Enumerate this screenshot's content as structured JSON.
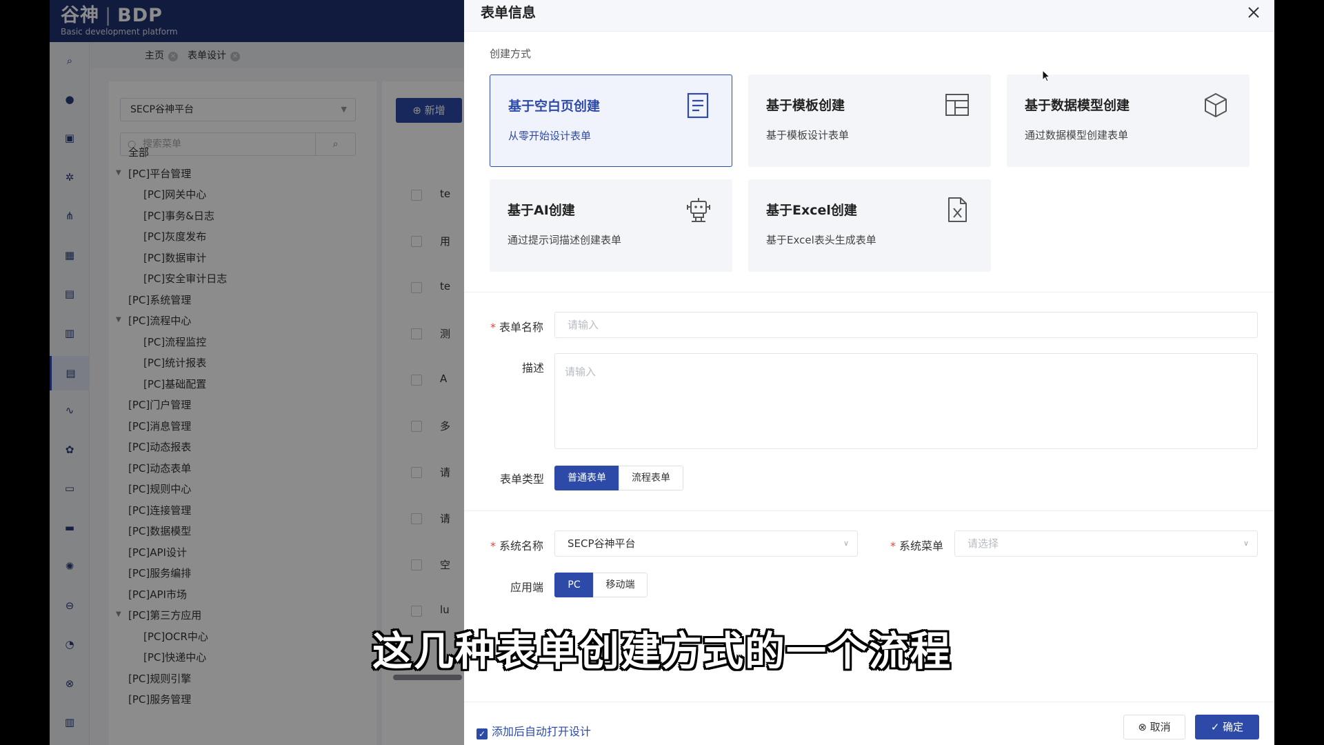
{
  "app": {
    "logo_brand": "谷神",
    "logo_name": "BDP",
    "logo_subtitle": "Basic development platform",
    "tabs": [
      {
        "label": "主页"
      },
      {
        "label": "表单设计"
      }
    ],
    "system_select": "SECP谷神平台",
    "menu_search_placeholder": "搜索菜单",
    "tree": [
      {
        "label": "全部",
        "level": 0,
        "caret": false
      },
      {
        "label": "[PC]平台管理",
        "level": 0,
        "caret": true
      },
      {
        "label": "[PC]网关中心",
        "level": 1,
        "caret": false
      },
      {
        "label": "[PC]事务&日志",
        "level": 1,
        "caret": false
      },
      {
        "label": "[PC]灰度发布",
        "level": 1,
        "caret": false
      },
      {
        "label": "[PC]数据审计",
        "level": 1,
        "caret": false
      },
      {
        "label": "[PC]安全审计日志",
        "level": 1,
        "caret": false
      },
      {
        "label": "[PC]系统管理",
        "level": 0,
        "caret": false
      },
      {
        "label": "[PC]流程中心",
        "level": 0,
        "caret": true
      },
      {
        "label": "[PC]流程监控",
        "level": 1,
        "caret": false
      },
      {
        "label": "[PC]统计报表",
        "level": 1,
        "caret": false
      },
      {
        "label": "[PC]基础配置",
        "level": 1,
        "caret": false
      },
      {
        "label": "[PC]门户管理",
        "level": 0,
        "caret": false
      },
      {
        "label": "[PC]消息管理",
        "level": 0,
        "caret": false
      },
      {
        "label": "[PC]动态报表",
        "level": 0,
        "caret": false
      },
      {
        "label": "[PC]动态表单",
        "level": 0,
        "caret": false
      },
      {
        "label": "[PC]规则中心",
        "level": 0,
        "caret": false
      },
      {
        "label": "[PC]连接管理",
        "level": 0,
        "caret": false
      },
      {
        "label": "[PC]数据模型",
        "level": 0,
        "caret": false
      },
      {
        "label": "[PC]API设计",
        "level": 0,
        "caret": false
      },
      {
        "label": "[PC]服务编排",
        "level": 0,
        "caret": false
      },
      {
        "label": "[PC]API市场",
        "level": 0,
        "caret": false
      },
      {
        "label": "[PC]第三方应用",
        "level": 0,
        "caret": true
      },
      {
        "label": "[PC]OCR中心",
        "level": 1,
        "caret": false
      },
      {
        "label": "[PC]快递中心",
        "level": 1,
        "caret": false
      },
      {
        "label": "[PC]规则引擎",
        "level": 0,
        "caret": false
      },
      {
        "label": "[PC]服务管理",
        "level": 0,
        "caret": false
      }
    ],
    "add_button": "新增",
    "row_texts": [
      "te",
      "用",
      "te",
      "测",
      "A",
      "多",
      "请",
      "请",
      "空",
      "lu"
    ]
  },
  "drawer": {
    "title": "表单信息",
    "section_label": "创建方式",
    "cards": [
      {
        "title": "基于空白页创建",
        "desc": "从零开始设计表单",
        "icon": "document-icon",
        "selected": true
      },
      {
        "title": "基于模板创建",
        "desc": "基于模板设计表单",
        "icon": "template-icon",
        "selected": false
      },
      {
        "title": "基于数据模型创建",
        "desc": "通过数据模型创建表单",
        "icon": "cube-icon",
        "selected": false
      },
      {
        "title": "基于AI创建",
        "desc": "通过提示词描述创建表单",
        "icon": "robot-icon",
        "selected": false
      },
      {
        "title": "基于Excel创建",
        "desc": "基于Excel表头生成表单",
        "icon": "excel-file-icon",
        "selected": false
      }
    ],
    "form": {
      "name_label": "表单名称",
      "name_placeholder": "请输入",
      "desc_label": "描述",
      "desc_placeholder": "请输入",
      "type_label": "表单类型",
      "type_options": [
        "普通表单",
        "流程表单"
      ],
      "type_selected": "普通表单",
      "system_label": "系统名称",
      "system_value": "SECP谷神平台",
      "menu_label": "系统菜单",
      "menu_placeholder": "请选择",
      "client_label": "应用端",
      "client_options": [
        "PC",
        "移动端"
      ],
      "client_selected": "PC"
    },
    "auto_open_label": "添加后自动打开设计",
    "auto_open_checked": true,
    "cancel_label": "取消",
    "ok_label": "确定"
  },
  "subtitle": "这几种表单创建方式的一个流程",
  "colors": {
    "primary": "#2d4aa8",
    "header": "#1e3270",
    "required": "#e0453a"
  }
}
